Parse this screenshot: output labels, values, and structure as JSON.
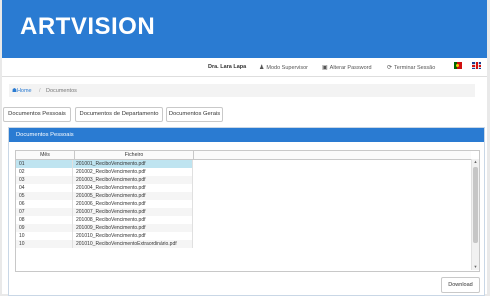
{
  "header": {
    "logo": "ARTVISION",
    "brand_color": "#2a7bd2"
  },
  "userbar": {
    "user_name": "Dra. Lara Lapa",
    "supervisor_label": "Modo Supervisor",
    "password_label": "Alterar Password",
    "logout_label": "Terminar Sessão"
  },
  "breadcrumb": {
    "home": "Home",
    "current": "Documentos"
  },
  "tabs": [
    {
      "label": "Documentos Pessoais"
    },
    {
      "label": "Documentos de Departamento"
    },
    {
      "label": "Documentos Gerais"
    }
  ],
  "panel": {
    "title": "Documentos Pessoais"
  },
  "table": {
    "columns": [
      "Mês",
      "Ficheiro"
    ],
    "rows": [
      {
        "month": "01",
        "file": "201001_ReciboVencimento.pdf"
      },
      {
        "month": "02",
        "file": "201002_ReciboVencimento.pdf"
      },
      {
        "month": "03",
        "file": "201003_ReciboVencimento.pdf"
      },
      {
        "month": "04",
        "file": "201004_ReciboVencimento.pdf"
      },
      {
        "month": "05",
        "file": "201005_ReciboVencimento.pdf"
      },
      {
        "month": "06",
        "file": "201006_ReciboVencimento.pdf"
      },
      {
        "month": "07",
        "file": "201007_ReciboVencimento.pdf"
      },
      {
        "month": "08",
        "file": "201008_ReciboVencimento.pdf"
      },
      {
        "month": "09",
        "file": "201009_ReciboVencimento.pdf"
      },
      {
        "month": "10",
        "file": "201010_ReciboVencimento.pdf"
      },
      {
        "month": "10",
        "file": "201010_ReciboVencimentoExtraordinário.pdf"
      }
    ]
  },
  "download_label": "Download"
}
